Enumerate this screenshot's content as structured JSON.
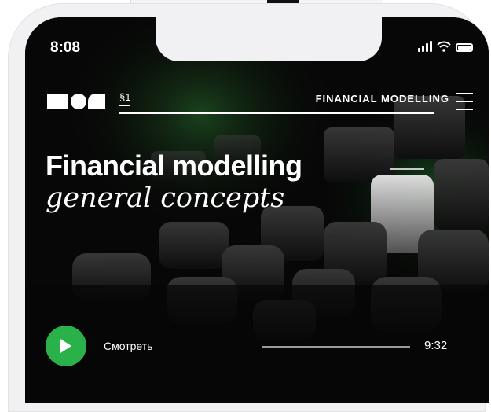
{
  "status_bar": {
    "time": "8:08"
  },
  "header": {
    "section": "§1",
    "title": "FINANCIAL MODELLING"
  },
  "hero": {
    "title": "Financial modelling",
    "subtitle": "general concepts"
  },
  "player": {
    "watch_label": "Смотреть",
    "duration": "9:32",
    "progress": 0,
    "accent": "#2bb14a"
  },
  "icons": [
    "brand-logo",
    "menu-icon",
    "play-icon",
    "signal-icon",
    "wifi-icon",
    "battery-icon"
  ]
}
